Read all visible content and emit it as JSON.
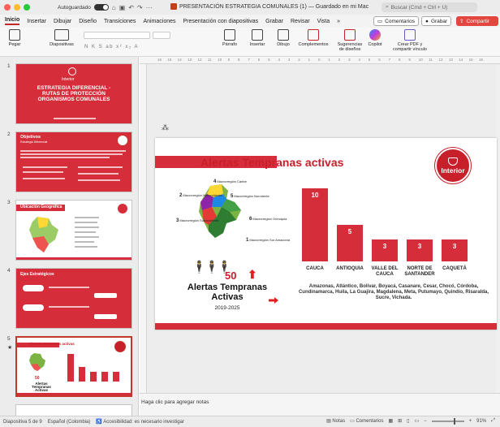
{
  "titlebar": {
    "autosave": "Autoguardado",
    "doc_title": "PRESENTACIÓN ESTRATEGIA COMUNALES (1) — Guardado en mi Mac",
    "search_placeholder": "Buscar (Cmd + Ctrl + U)"
  },
  "tabs": [
    "Inicio",
    "Insertar",
    "Dibujar",
    "Diseño",
    "Transiciones",
    "Animaciones",
    "Presentación con diapositivas",
    "Grabar",
    "Revisar",
    "Vista"
  ],
  "active_tab": "Inicio",
  "right_buttons": {
    "comments": "Comentarios",
    "record": "Grabar",
    "share": "Compartir"
  },
  "ribbon": {
    "paste": "Pegar",
    "slides": "Diapositivas",
    "paragraph": "Párrafo",
    "insert": "Insertar",
    "draw": "Dibujo",
    "addins": "Complementos",
    "designer": "Sugerencias de diseños",
    "copilot": "Copilot",
    "pdf": "Crear PDF y compartir vínculo"
  },
  "ruler_marks": [
    "16",
    "15",
    "14",
    "13",
    "12",
    "11",
    "10",
    "9",
    "8",
    "7",
    "6",
    "5",
    "4",
    "3",
    "2",
    "1",
    "0",
    "1",
    "2",
    "3",
    "4",
    "5",
    "6",
    "7",
    "8",
    "9",
    "10",
    "11",
    "12",
    "13",
    "14",
    "15",
    "16"
  ],
  "thumbnails": [
    {
      "num": "1",
      "title": "ESTRATEGIA DIFERENCIAL - RUTAS DE PROTECCIÓN ORGANISMOS COMUNALES",
      "logo_text": "Interior"
    },
    {
      "num": "2",
      "title": "Objetivos",
      "subtitle": "Estrategia Diferencial"
    },
    {
      "num": "3",
      "title": "Ubicación Geográfica"
    },
    {
      "num": "4",
      "title": "Ejes Estratégicos"
    },
    {
      "num": "5",
      "title": "Alertas Tempranas activas",
      "selected": true
    }
  ],
  "slide": {
    "title": "Alertas Tempranas activas",
    "logo": "Interior",
    "count": "50",
    "main_label": "Alertas Tempranas Activas",
    "years": "2019-2025",
    "regions": [
      {
        "num": "4",
        "name": "Macrorregión Caribe"
      },
      {
        "num": "2",
        "name": "Macrorregión Noroccidente"
      },
      {
        "num": "5",
        "name": "Macrorregión Nororiente"
      },
      {
        "num": "3",
        "name": "Macrorregión Suroccidente"
      },
      {
        "num": "6",
        "name": "Macrorregión Orinoquia"
      },
      {
        "num": "1",
        "name": "Macrorregión Sur Amazonía"
      }
    ],
    "departments_text": "Amazonas, Atlántico, Bolívar, Boyacá, Casanare, Cesar, Chocó, Córdoba, Cundinamarca, Huila, La Guajira, Magdalena, Meta, Putumayo, Quindío, Risaralda, Sucre, Vichada."
  },
  "chart_data": {
    "type": "bar",
    "categories": [
      "CAUCA",
      "ANTIOQUIA",
      "VALLE DEL CAUCA",
      "NORTE DE SANTANDER",
      "CAQUETÁ"
    ],
    "values": [
      10,
      5,
      3,
      3,
      3
    ],
    "ylim": [
      0,
      10
    ],
    "bar_color": "#d52e3a"
  },
  "notes_placeholder": "Haga clic para agregar notas",
  "status": {
    "slide_info": "Diapositiva 5 de 9",
    "language": "Español (Colombia)",
    "accessibility": "Accesibilidad: es necesario investigar",
    "notes": "Notas",
    "comments": "Comentarios",
    "zoom": "91%"
  },
  "colors": {
    "accent": "#c5262b",
    "brand_red": "#d52e3a"
  }
}
